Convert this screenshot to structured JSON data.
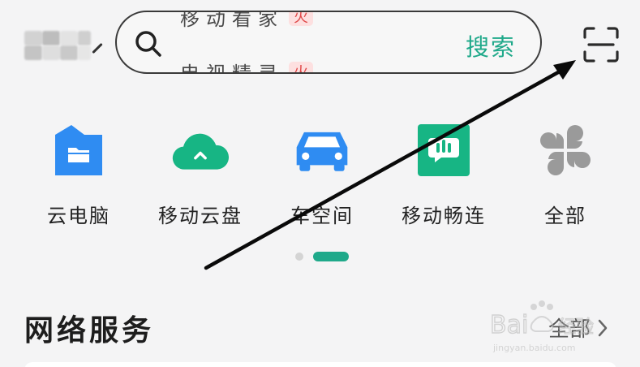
{
  "search": {
    "hot_top": "移动看家",
    "hot_top_tag": "火",
    "hot_bottom": "电视精灵",
    "hot_bottom_tag": "火",
    "button_label": "搜索"
  },
  "apps": [
    {
      "label": "云电脑",
      "icon": "folder-icon",
      "color": "#2f8cf2"
    },
    {
      "label": "移动云盘",
      "icon": "cloud-upload-icon",
      "color": "#17b584"
    },
    {
      "label": "车空间",
      "icon": "car-icon",
      "color": "#2f8cf2"
    },
    {
      "label": "移动畅连",
      "icon": "chat-bubble-icon",
      "color": "#17b584"
    },
    {
      "label": "全部",
      "icon": "four-petal-icon",
      "color": "#9a9a9a"
    }
  ],
  "section": {
    "title": "网络服务",
    "all_label": "全部"
  },
  "watermark": {
    "brand": "Baidu经验",
    "url": "jingyan.baidu.com"
  },
  "colors": {
    "accent": "#1fa98a",
    "blue": "#2f8cf2",
    "hot_tag": "#e04a4a"
  }
}
